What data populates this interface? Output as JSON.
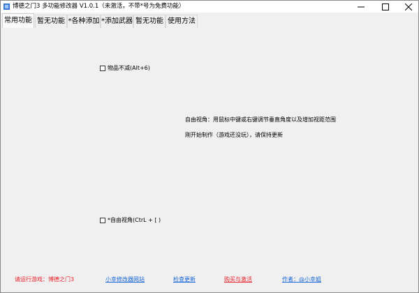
{
  "window": {
    "title": "博德之门3 多功能修改器  V1.0.1（未激活，不带*号为免费功能）",
    "icon": "app-icon",
    "controls": [
      "minimize-icon",
      "maximize-icon",
      "close-icon"
    ]
  },
  "tabs": [
    {
      "label": "常用功能",
      "active": true
    },
    {
      "label": "暂无功能",
      "active": false
    },
    {
      "label": "*各种添加",
      "active": false
    },
    {
      "label": "*添加武器",
      "active": false
    },
    {
      "label": "暂无功能",
      "active": false
    },
    {
      "label": "使用方法",
      "active": false
    }
  ],
  "panel": {
    "checkbox_item_no_consume": "物品不减(Alt+6)",
    "checkbox_free_view": "*自由视角(CtrL + [ )",
    "free_view_desc": "自由视角：用鼠标中键或右键调节垂直角度以及增加视距范围",
    "free_view_note": "刚开始制作（游戏还没玩），请保持更新"
  },
  "footer": {
    "run_game": "请运行游戏：博德之门3",
    "site_link": "小幸修改器网站",
    "check_update": "检查更新",
    "buy_activate": "购买与激活",
    "author": "作者：@小幸姐"
  },
  "colors": {
    "red": "#e8222b",
    "blue": "#1565d8",
    "background": "#f0f0f0"
  }
}
